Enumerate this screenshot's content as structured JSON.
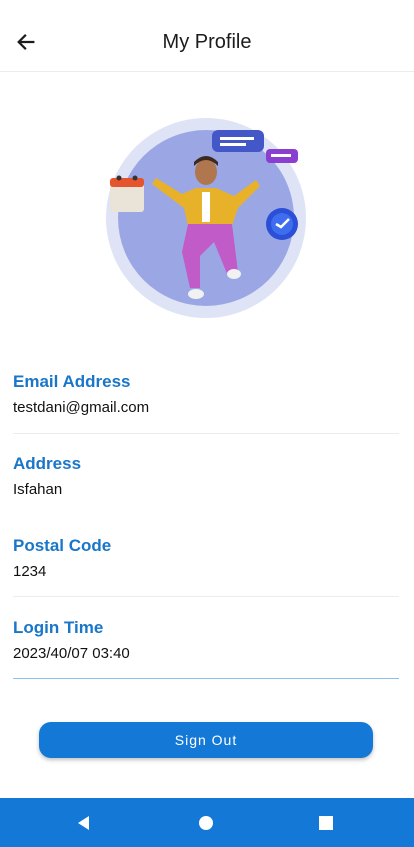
{
  "header": {
    "title": "My Profile",
    "back_icon": "arrow-left-icon"
  },
  "profile": {
    "fields": [
      {
        "label": "Email Address",
        "value": "testdani@gmail.com"
      },
      {
        "label": "Address",
        "value": "Isfahan"
      },
      {
        "label": "Postal Code",
        "value": "1234"
      },
      {
        "label": "Login Time",
        "value": "2023/40/07 03:40"
      }
    ]
  },
  "actions": {
    "sign_out_label": "Sign Out"
  },
  "system_nav": {
    "back_icon": "triangle-back-icon",
    "home_icon": "circle-home-icon",
    "recents_icon": "square-recents-icon"
  },
  "colors": {
    "accent": "#1479d6",
    "label": "#1976c8",
    "illustration_circle": "#9aa7e4"
  }
}
